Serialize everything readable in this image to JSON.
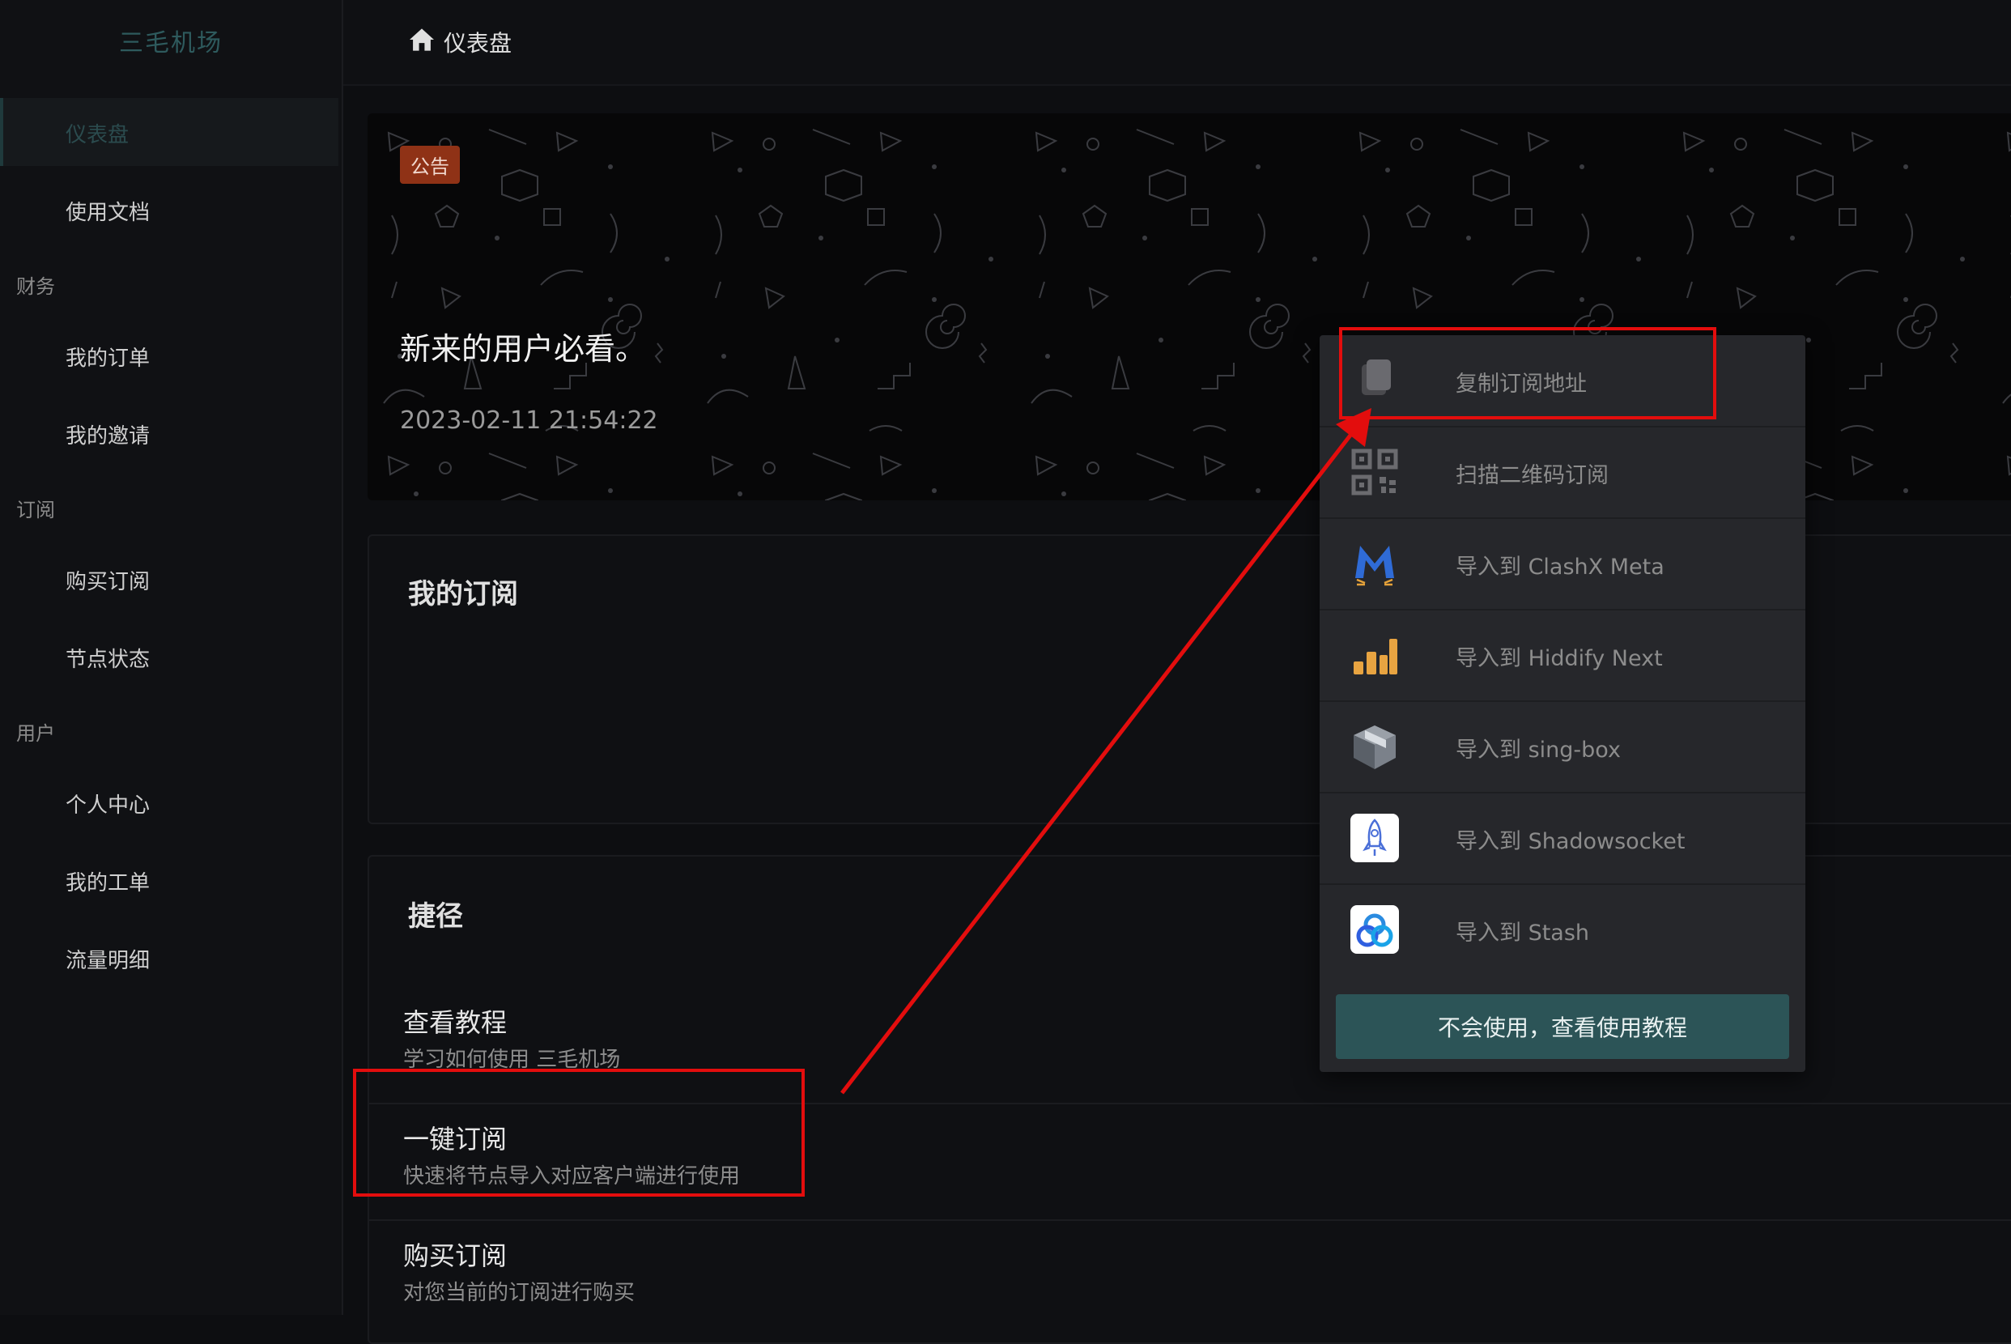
{
  "app": {
    "brand": "三毛机场"
  },
  "sidebar": {
    "items": [
      {
        "label": "仪表盘",
        "active": true
      },
      {
        "label": "使用文档"
      }
    ],
    "sections": [
      {
        "title": "财务",
        "items": [
          "我的订单",
          "我的邀请"
        ]
      },
      {
        "title": "订阅",
        "items": [
          "购买订阅",
          "节点状态"
        ]
      },
      {
        "title": "用户",
        "items": [
          "个人中心",
          "我的工单",
          "流量明细"
        ]
      }
    ]
  },
  "header": {
    "breadcrumb": "仪表盘"
  },
  "notice": {
    "badge": "公告",
    "title": "新来的用户必看。",
    "date": "2023-02-11 21:54:22"
  },
  "subscription_card": {
    "title": "我的订阅"
  },
  "shortcuts": {
    "title": "捷径",
    "items": [
      {
        "title": "查看教程",
        "desc": "学习如何使用 三毛机场"
      },
      {
        "title": "一键订阅",
        "desc": "快速将节点导入对应客户端进行使用"
      },
      {
        "title": "购买订阅",
        "desc": "对您当前的订阅进行购买"
      }
    ]
  },
  "subscribe_menu": {
    "items": [
      {
        "label": "复制订阅地址",
        "icon": "copy-icon"
      },
      {
        "label": "扫描二维码订阅",
        "icon": "qr-code-icon"
      },
      {
        "label": "导入到 ClashX Meta",
        "icon": "clashx-meta-icon"
      },
      {
        "label": "导入到 Hiddify Next",
        "icon": "hiddify-icon"
      },
      {
        "label": "导入到 sing-box",
        "icon": "sing-box-icon"
      },
      {
        "label": "导入到 Shadowsocket",
        "icon": "shadowrocket-icon"
      },
      {
        "label": "导入到 Stash",
        "icon": "stash-icon"
      }
    ],
    "help_button": "不会使用，查看使用教程"
  },
  "colors": {
    "brand": "#2e5a5d",
    "badge": "#8f3216",
    "help_button": "#2c5457",
    "annotation": "#e30d0d"
  }
}
